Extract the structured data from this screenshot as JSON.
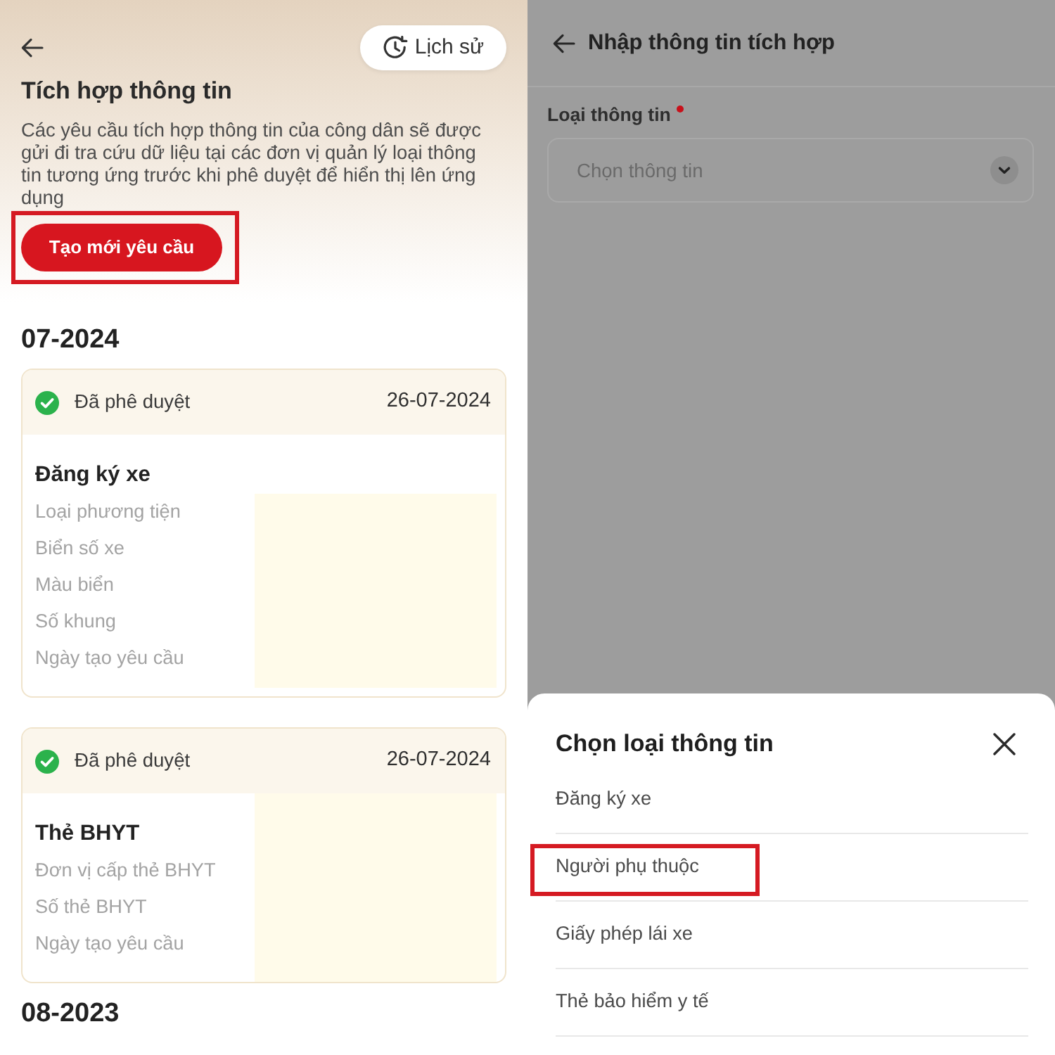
{
  "history_screen": {
    "history_button": {
      "label": "Lịch sử"
    },
    "title": "Tích hợp thông tin",
    "description": "Các yêu cầu tích hợp thông tin của công dân sẽ được gửi đi tra cứu dữ liệu tại các đơn vị quản lý loại thông tin tương ứng trước khi phê duyệt để hiển thị lên ứng dụng",
    "create_button": {
      "label": "Tạo mới yêu cầu",
      "highlighted": true
    },
    "groups": [
      {
        "month": "07-2024",
        "requests": [
          {
            "status": "Đã phê duyệt",
            "date": "26-07-2024",
            "title": "Đăng ký xe",
            "fields": [
              "Loại phương tiện",
              "Biển số xe",
              "Màu biển",
              "Số khung",
              "Ngày tạo yêu cầu"
            ],
            "values_hidden": true
          },
          {
            "status": "Đã phê duyệt",
            "date": "26-07-2024",
            "title": "Thẻ BHYT",
            "fields": [
              "Đơn vị cấp thẻ BHYT",
              "Số thẻ BHYT",
              "Ngày tạo yêu cầu"
            ],
            "values_hidden": true
          }
        ]
      },
      {
        "month": "08-2023"
      }
    ]
  },
  "form_screen": {
    "dimmed": true,
    "title": "Nhập thông tin tích hợp",
    "field": {
      "label": "Loại thông tin",
      "required": true,
      "placeholder": "Chọn thông tin"
    },
    "sheet": {
      "title": "Chọn loại thông tin",
      "options": [
        {
          "label": "Đăng ký xe",
          "highlighted": false
        },
        {
          "label": "Người phụ thuộc",
          "highlighted": true
        },
        {
          "label": "Giấy phép lái xe",
          "highlighted": false
        },
        {
          "label": "Thẻ bảo hiểm y tế",
          "highlighted": false
        }
      ]
    }
  }
}
